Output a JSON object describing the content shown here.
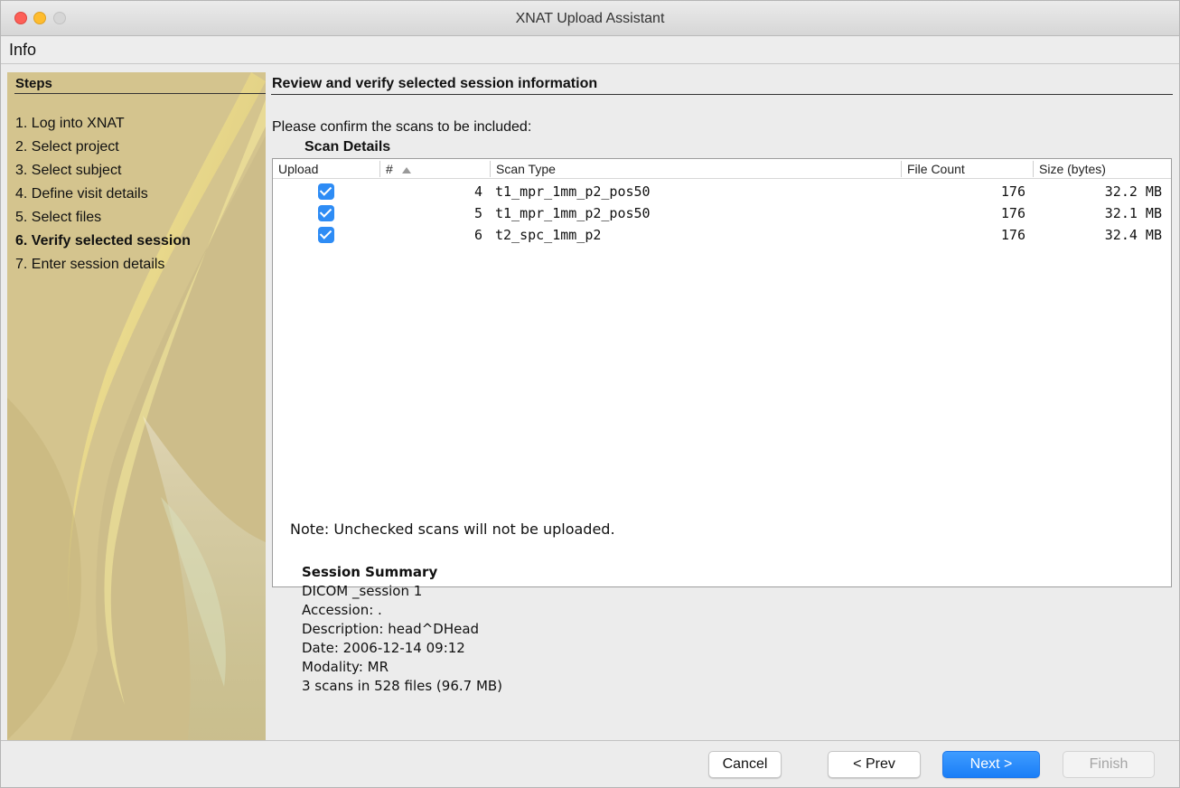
{
  "window": {
    "title": "XNAT Upload Assistant"
  },
  "menu": {
    "info": "Info"
  },
  "steps": {
    "header": "Steps",
    "items": [
      {
        "label": "1. Log into XNAT"
      },
      {
        "label": "2. Select project"
      },
      {
        "label": "3. Select subject"
      },
      {
        "label": "4. Define visit details"
      },
      {
        "label": "5. Select files"
      },
      {
        "label": "6. Verify selected session",
        "active": true
      },
      {
        "label": "7. Enter session details"
      }
    ]
  },
  "main": {
    "section_title": "Review and verify selected session information",
    "confirm_text": "Please confirm the scans to be included:",
    "table_title": "Scan Details",
    "columns": [
      "Upload",
      "#",
      "Scan Type",
      "File Count",
      "Size (bytes)"
    ],
    "rows": [
      {
        "checked": true,
        "num": "4",
        "type": "t1_mpr_1mm_p2_pos50",
        "count": "176",
        "size": "32.2 MB"
      },
      {
        "checked": true,
        "num": "5",
        "type": "t1_mpr_1mm_p2_pos50",
        "count": "176",
        "size": "32.1 MB"
      },
      {
        "checked": true,
        "num": "6",
        "type": "t2_spc_1mm_p2",
        "count": "176",
        "size": "32.4 MB"
      }
    ],
    "note": "Note: Unchecked scans will not be uploaded.",
    "summary": {
      "title": "Session Summary",
      "lines": [
        "DICOM _session 1",
        "Accession: .",
        "Description: head^DHead",
        "Date: 2006-12-14 09:12",
        "Modality: MR",
        "3 scans in 528 files (96.7 MB)"
      ]
    }
  },
  "buttons": {
    "cancel": "Cancel",
    "prev": "< Prev",
    "next": "Next >",
    "finish": "Finish"
  },
  "colors": {
    "accent": "#1a7ef7",
    "checkbox": "#2e8cf5"
  }
}
